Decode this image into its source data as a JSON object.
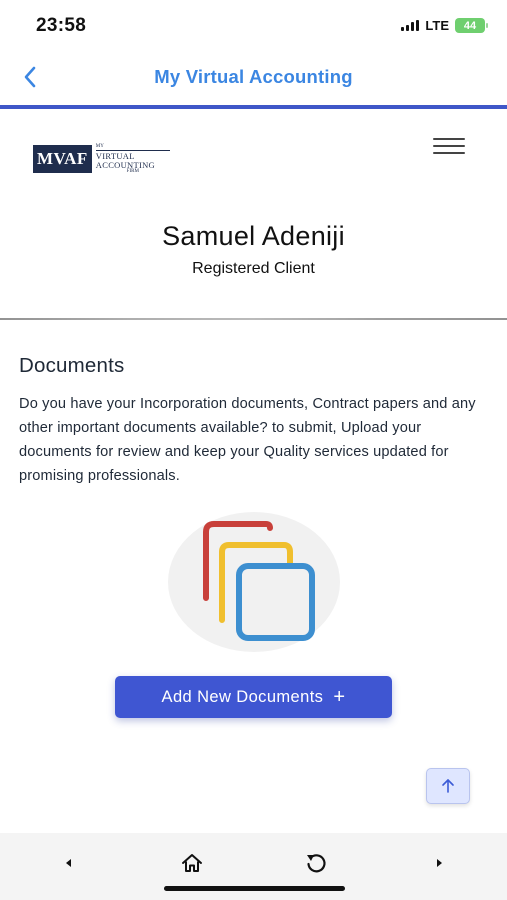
{
  "status_bar": {
    "time": "23:58",
    "network": "LTE",
    "battery": "44"
  },
  "nav": {
    "back_icon": "chevron-left-icon",
    "title": "My Virtual Accounting"
  },
  "site_header": {
    "logo": {
      "abbr": "MVAF",
      "line1": "MY",
      "line2": "VIRTUAL",
      "line3": "ACCOUNTING",
      "line4": "FIRM"
    },
    "menu_icon": "hamburger-menu-icon"
  },
  "profile": {
    "name": "Samuel Adeniji",
    "role": "Registered Client"
  },
  "documents": {
    "title": "Documents",
    "description": "Do you have your Incorporation documents, Contract papers and any other important documents available? to submit, Upload your documents for review and keep your Quality services updated for promising professionals.",
    "illustration_icon": "stacked-documents-icon",
    "add_button_label": "Add New Documents",
    "add_button_icon": "+"
  },
  "scroll_top_icon": "arrow-up-icon",
  "bottom_bar": {
    "icons": [
      "triangle-left-icon",
      "home-icon",
      "reload-icon",
      "triangle-right-icon"
    ]
  },
  "colors": {
    "nav_title": "#3b86e2",
    "divider": "#3f57c8",
    "primary_button": "#3f56d2",
    "logo_navy": "#1f2d4d",
    "doc_red": "#c8403a",
    "doc_yellow": "#f0bf2e",
    "doc_blue": "#3d8fd0"
  }
}
